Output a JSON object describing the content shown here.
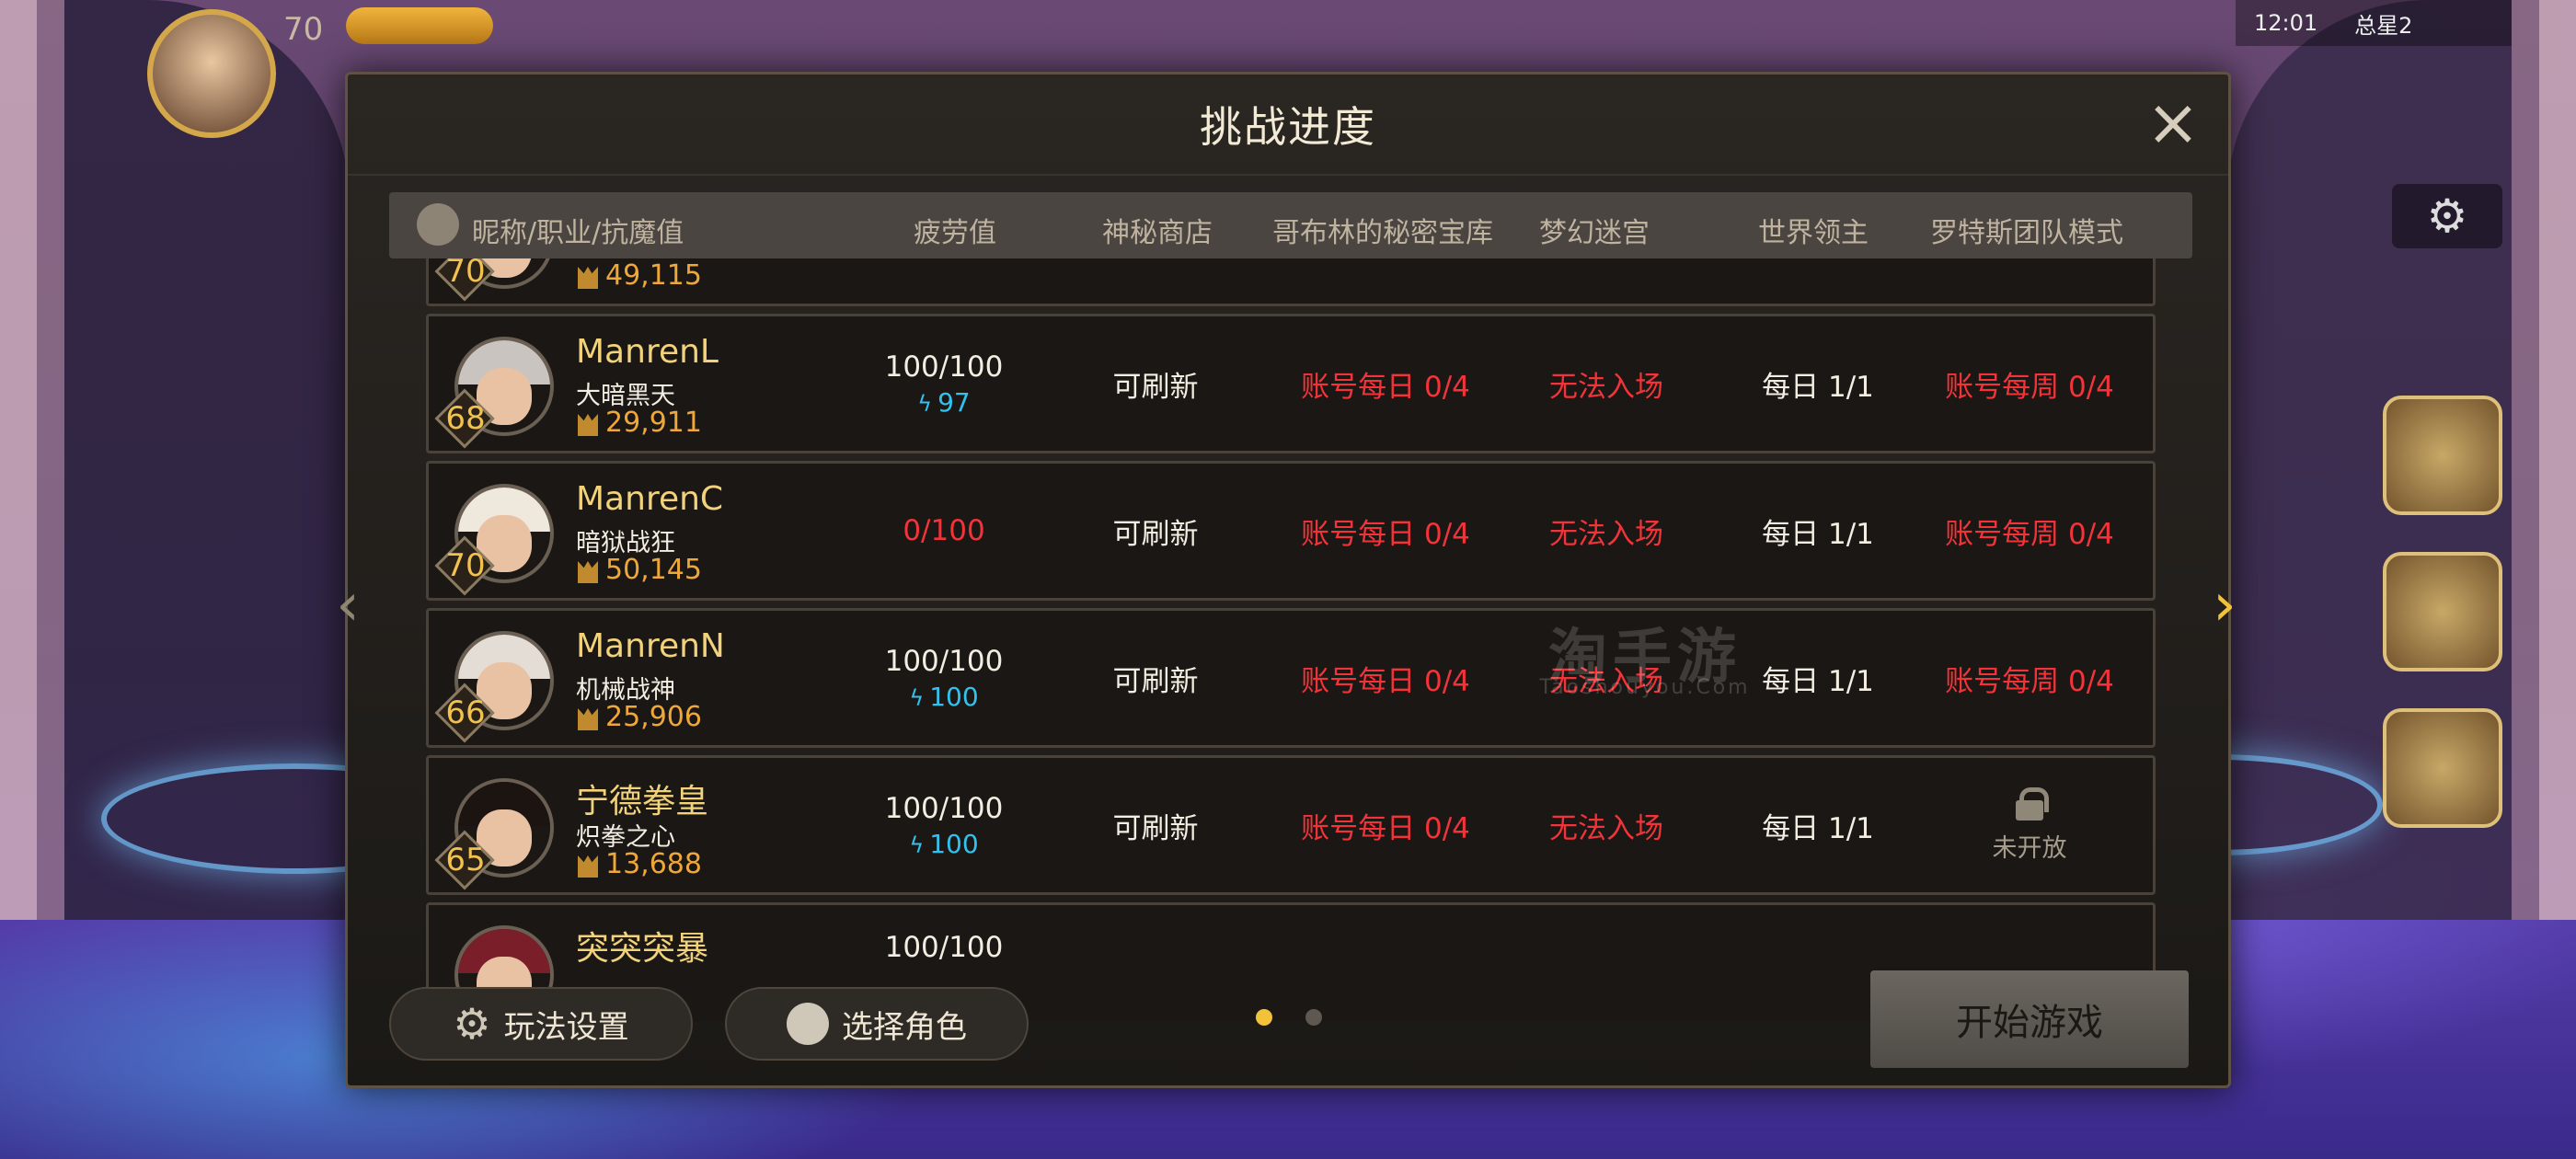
{
  "hud": {
    "player_level": "70",
    "status_time": "12:01",
    "status_right": "总星2"
  },
  "modal": {
    "title": "挑战进度",
    "headers": {
      "nickname": "昵称/职业/抗魔值",
      "fatigue": "疲劳值",
      "shop": "神秘商店",
      "goblin": "哥布林的秘密宝库",
      "maze": "梦幻迷宫",
      "boss": "世界领主",
      "rotes": "罗特斯团队模式"
    },
    "rows": [
      {
        "level": "70",
        "nickname": "",
        "job": "",
        "power": "49,115",
        "fatigue": "",
        "fatigue_bonus": "",
        "shop": "",
        "goblin": "",
        "maze": "",
        "boss": "",
        "rotes": "",
        "hair": "#9a9aa8"
      },
      {
        "level": "68",
        "nickname": "ManrenL",
        "job": "大暗黑天",
        "power": "29,911",
        "fatigue": "100/100",
        "fatigue_bonus": "97",
        "shop": "可刷新",
        "goblin": "账号每日 0/4",
        "maze": "无法入场",
        "boss": "每日 1/1",
        "rotes": "账号每周 0/4",
        "hair": "#c9c4c0"
      },
      {
        "level": "70",
        "nickname": "ManrenC",
        "job": "暗狱战狂",
        "power": "50,145",
        "fatigue": "0/100",
        "fatigue_bonus": "",
        "shop": "可刷新",
        "goblin": "账号每日 0/4",
        "maze": "无法入场",
        "boss": "每日 1/1",
        "rotes": "账号每周 0/4",
        "hair": "#efe8dc"
      },
      {
        "level": "66",
        "nickname": "ManrenN",
        "job": "机械战神",
        "power": "25,906",
        "fatigue": "100/100",
        "fatigue_bonus": "100",
        "shop": "可刷新",
        "goblin": "账号每日 0/4",
        "maze": "无法入场",
        "boss": "每日 1/1",
        "rotes": "账号每周 0/4",
        "hair": "#e4ddd6"
      },
      {
        "level": "65",
        "nickname": "宁德拳皇",
        "job": "炽拳之心",
        "power": "13,688",
        "fatigue": "100/100",
        "fatigue_bonus": "100",
        "shop": "可刷新",
        "goblin": "账号每日 0/4",
        "maze": "无法入场",
        "boss": "每日 1/1",
        "rotes_locked": "未开放",
        "hair": "#1c1410"
      },
      {
        "level": "",
        "nickname": "突突突暴",
        "job": "",
        "power": "",
        "fatigue": "100/100",
        "fatigue_bonus": "",
        "shop": "",
        "goblin": "",
        "maze": "",
        "boss": "",
        "rotes": "",
        "hair": "#7a1e2a"
      }
    ],
    "footer": {
      "settings": "玩法设置",
      "select_role": "选择角色",
      "start": "开始游戏",
      "page_current": 1,
      "page_total": 2
    },
    "watermark": "淘手游",
    "watermark_sub": "Taoshouyou.Com"
  },
  "icons": {
    "close": "close-icon",
    "bolt": "bolt-icon",
    "lock": "lock-icon",
    "gear": "gear-icon",
    "power": "demon-power-icon"
  },
  "colors": {
    "red_status": "#f2343a",
    "blue_fatigue": "#32c2f0",
    "gold_name": "#f2d27a",
    "power_orange": "#f0a73a",
    "active_dot": "#f2c23a"
  }
}
